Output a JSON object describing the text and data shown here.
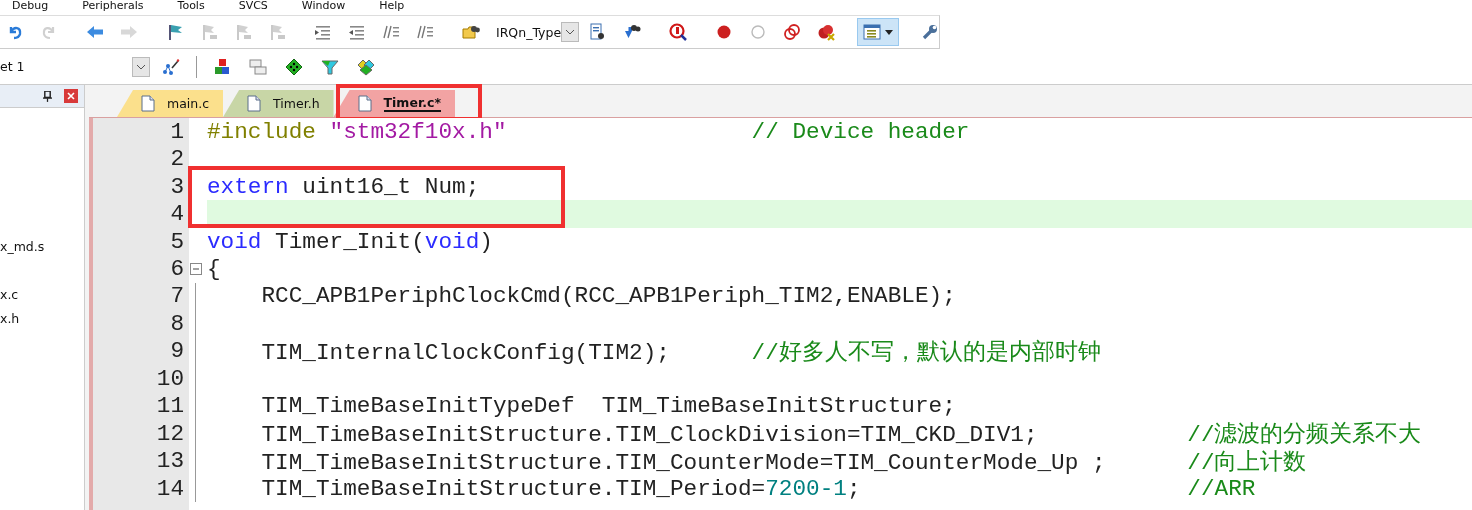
{
  "menu": [
    "Debug",
    "Peripherals",
    "Tools",
    "SVCS",
    "Window",
    "Help"
  ],
  "toolbar": {
    "groups": [
      {
        "items": [
          {
            "kind": "undo",
            "disabled": false
          },
          {
            "kind": "redo",
            "disabled": true
          }
        ]
      },
      {
        "items": [
          {
            "kind": "back",
            "disabled": false
          },
          {
            "kind": "forward",
            "disabled": true
          }
        ]
      },
      {
        "items": [
          {
            "kind": "bookmark",
            "disabled": false
          },
          {
            "kind": "bookmark-prev",
            "disabled": true
          },
          {
            "kind": "bookmark-next",
            "disabled": true
          },
          {
            "kind": "bookmark-clear",
            "disabled": true
          }
        ]
      },
      {
        "items": [
          {
            "kind": "indent",
            "disabled": false
          },
          {
            "kind": "unindent",
            "disabled": false
          },
          {
            "kind": "comment",
            "disabled": false
          },
          {
            "kind": "uncomment",
            "disabled": false
          }
        ]
      },
      {
        "items": [
          {
            "kind": "find-files",
            "disabled": false
          },
          {
            "kind": "combo",
            "value": "IRQn_Type",
            "disabled": false
          },
          {
            "kind": "find",
            "disabled": false
          },
          {
            "kind": "incremental-find",
            "disabled": false
          }
        ]
      },
      {
        "items": [
          {
            "kind": "debug",
            "disabled": false
          }
        ]
      },
      {
        "items": [
          {
            "kind": "breakpoint",
            "disabled": false
          },
          {
            "kind": "breakpoint-off",
            "disabled": false
          },
          {
            "kind": "breakpoints-toggle",
            "disabled": false
          },
          {
            "kind": "breakpoints-kill",
            "disabled": false
          }
        ]
      },
      {
        "items": [
          {
            "kind": "window-menu",
            "disabled": false,
            "pressed": true
          }
        ]
      },
      {
        "items": [
          {
            "kind": "wrench",
            "disabled": false
          }
        ]
      }
    ]
  },
  "build_toolbar": {
    "groups": [
      {
        "items": [
          {
            "kind": "combo",
            "value": "et 1",
            "disabled": false
          },
          {
            "kind": "wand",
            "disabled": false
          }
        ]
      },
      {
        "items": [
          {
            "kind": "blocks",
            "disabled": false
          },
          {
            "kind": "windows",
            "disabled": false
          },
          {
            "kind": "diamond",
            "disabled": false
          },
          {
            "kind": "funnel",
            "disabled": false
          },
          {
            "kind": "diamonds",
            "disabled": false
          }
        ]
      }
    ]
  },
  "project_panel": {
    "items": [
      {
        "label": "x_md.s"
      },
      {
        "label": "x.c"
      },
      {
        "label": "x.h"
      }
    ]
  },
  "tabs": [
    {
      "label": "main.c",
      "color": "#fbe08c",
      "selected": false,
      "annotated": false
    },
    {
      "label": "Timer.h",
      "color": "#c8d6a6",
      "selected": false,
      "annotated": false
    },
    {
      "label": "Timer.c*",
      "color": "#f2a3a3",
      "selected": true,
      "annotated": true
    }
  ],
  "editor": {
    "lines": [
      {
        "number": "1",
        "current": false,
        "fold": false,
        "annotated": false,
        "segments": [
          {
            "kind": "preprocessor",
            "text": "#include "
          },
          {
            "kind": "string",
            "text": "\"stm32f10x.h\"                  "
          },
          {
            "kind": "comment",
            "text": "// Device header"
          }
        ]
      },
      {
        "number": "2",
        "current": false,
        "fold": false,
        "annotated": false
      },
      {
        "number": "3",
        "current": false,
        "fold": false,
        "annotated": true,
        "segments": [
          {
            "kind": "keyword",
            "text": "extern"
          },
          {
            "kind": "plain",
            "text": " uint16_t Num;"
          }
        ]
      },
      {
        "number": "4",
        "current": true,
        "fold": false,
        "annotated": true
      },
      {
        "number": "5",
        "current": false,
        "fold": false,
        "annotated": false,
        "segments": [
          {
            "kind": "keyword",
            "text": "void"
          },
          {
            "kind": "plain",
            "text": " Timer_Init("
          },
          {
            "kind": "keyword",
            "text": "void"
          },
          {
            "kind": "plain",
            "text": ")"
          }
        ]
      },
      {
        "number": "6",
        "current": false,
        "fold": true,
        "annotated": false,
        "segments": [
          {
            "kind": "plain",
            "text": "{"
          }
        ]
      },
      {
        "number": "7",
        "current": false,
        "fold": false,
        "annotated": false,
        "segments": [
          {
            "kind": "plain",
            "text": "    RCC_APB1PeriphClockCmd(RCC_APB1Periph_TIM2,ENABLE);"
          }
        ]
      },
      {
        "number": "8",
        "current": false,
        "fold": false,
        "annotated": false
      },
      {
        "number": "9",
        "current": false,
        "fold": false,
        "annotated": false,
        "segments": [
          {
            "kind": "plain",
            "text": "    TIM_InternalClockConfig(TIM2);      "
          },
          {
            "kind": "comment",
            "text": "//好多人不写，默认的是内部时钟"
          }
        ]
      },
      {
        "number": "10",
        "current": false,
        "fold": false,
        "annotated": false
      },
      {
        "number": "11",
        "current": false,
        "fold": false,
        "annotated": false,
        "segments": [
          {
            "kind": "plain",
            "text": "    TIM_TimeBaseInitTypeDef  TIM_TimeBaseInitStructure;"
          }
        ]
      },
      {
        "number": "12",
        "current": false,
        "fold": false,
        "annotated": false,
        "segments": [
          {
            "kind": "plain",
            "text": "    TIM_TimeBaseInitStructure.TIM_ClockDivision=TIM_CKD_DIV1;           "
          },
          {
            "kind": "comment",
            "text": "//滤波的分频关系不大"
          }
        ]
      },
      {
        "number": "13",
        "current": false,
        "fold": false,
        "annotated": false,
        "segments": [
          {
            "kind": "plain",
            "text": "    TIM_TimeBaseInitStructure.TIM_CounterMode=TIM_CounterMode_Up ;      "
          },
          {
            "kind": "comment",
            "text": "//向上计数"
          }
        ]
      },
      {
        "number": "14",
        "current": false,
        "fold": false,
        "annotated": false,
        "segments": [
          {
            "kind": "plain",
            "text": "    TIM_TimeBaseInitStructure.TIM_Period="
          },
          {
            "kind": "number",
            "text": "7200-1"
          },
          {
            "kind": "plain",
            "text": ";                        "
          },
          {
            "kind": "comment",
            "text": "//ARR"
          }
        ]
      }
    ]
  }
}
